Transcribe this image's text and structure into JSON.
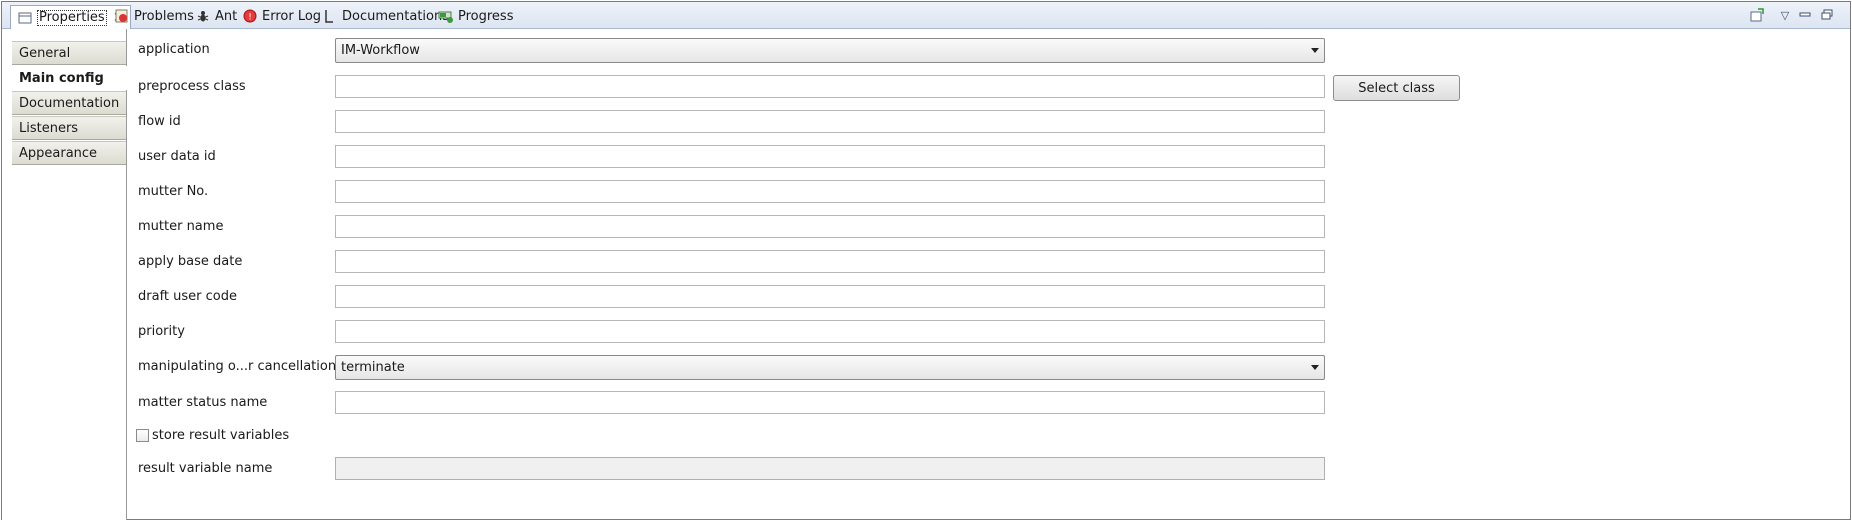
{
  "tabs": [
    {
      "label": "Properties",
      "icon": "properties-icon",
      "active": true
    },
    {
      "label": "Problems",
      "icon": "problems-icon"
    },
    {
      "label": "Ant",
      "icon": "ant-icon"
    },
    {
      "label": "Error Log",
      "icon": "error-log-icon"
    },
    {
      "label": "Documentations",
      "icon": "documentations-icon"
    },
    {
      "label": "Progress",
      "icon": "progress-icon"
    }
  ],
  "sidebar": {
    "items": [
      {
        "label": "General"
      },
      {
        "label": "Main config",
        "selected": true
      },
      {
        "label": "Documentation"
      },
      {
        "label": "Listeners"
      },
      {
        "label": "Appearance"
      }
    ]
  },
  "form": {
    "application": {
      "label": "application",
      "value": "IM-Workflow"
    },
    "preprocess_class": {
      "label": "preprocess class",
      "value": "",
      "button": "Select class"
    },
    "flow_id": {
      "label": "flow id",
      "value": ""
    },
    "user_data_id": {
      "label": "user data id",
      "value": ""
    },
    "mutter_no": {
      "label": "mutter No.",
      "value": ""
    },
    "mutter_name": {
      "label": "mutter name",
      "value": ""
    },
    "apply_base_date": {
      "label": "apply base date",
      "value": ""
    },
    "draft_user_code": {
      "label": "draft user code",
      "value": ""
    },
    "priority": {
      "label": "priority",
      "value": ""
    },
    "manipulating_cancellation": {
      "label": "manipulating o...r cancellation",
      "value": "terminate"
    },
    "matter_status_name": {
      "label": "matter status name",
      "value": ""
    },
    "store_result_variables": {
      "label": "store result variables",
      "checked": false
    },
    "result_variable_name": {
      "label": "result variable name",
      "value": "",
      "disabled": true
    }
  },
  "colors": {
    "tabbar": "#dde5f2",
    "sidebar_item": "#dcdcd2",
    "border": "#b7b7b7"
  }
}
